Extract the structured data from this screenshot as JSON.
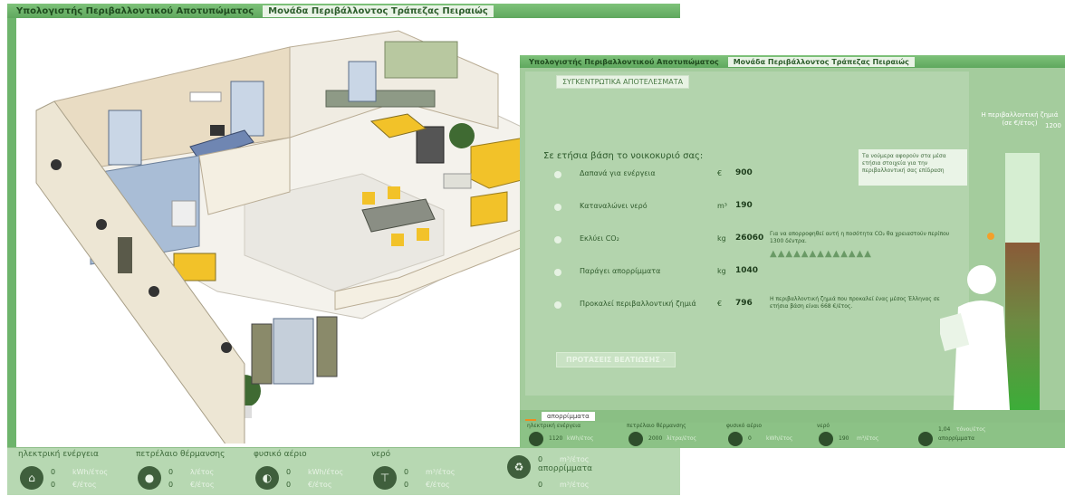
{
  "colors": {
    "title_bar": "#5fa85e",
    "panel_green": "#a4cc9d",
    "footer_green": "#b7d8b2",
    "accent_orange": "#f08a1e",
    "furniture_yellow": "#f2c229"
  },
  "window_main": {
    "tabs": [
      "Υπολογιστής Περιβαλλοντικού Αποτυπώματος",
      "Μονάδα Περιβάλλοντος Τράπεζας Πειραιώς"
    ],
    "footer": {
      "categories": [
        {
          "title": "ηλεκτρική ενέργεια",
          "icon": "house-icon",
          "v1": "0",
          "u1": "kWh/έτος",
          "v2": "0",
          "u2": "€/έτος"
        },
        {
          "title": "πετρέλαιο θέρμανσης",
          "icon": "oil-drop-icon",
          "v1": "0",
          "u1": "λ/έτος",
          "v2": "0",
          "u2": "€/έτος"
        },
        {
          "title": "φυσικό αέριο",
          "icon": "gas-icon",
          "v1": "0",
          "u1": "kWh/έτος",
          "v2": "0",
          "u2": "€/έτος"
        },
        {
          "title": "νερό",
          "icon": "tap-icon",
          "v1": "0",
          "u1": "m³/έτος",
          "v2": "0",
          "u2": "€/έτος"
        },
        {
          "title": "απορρίμματα",
          "icon": "recycle-bin-icon",
          "v1": "0",
          "u1": "m³/έτος",
          "v2": "0",
          "u2": "m³/έτος"
        }
      ]
    }
  },
  "window_results": {
    "tabs": [
      "Υπολογιστής Περιβαλλοντικού Αποτυπώματος",
      "Μονάδα Περιβάλλοντος Τράπεζας Πειραιώς"
    ],
    "summary_tab": "ΣΥΓΚΕΝΤΡΩΤΙΚΑ ΑΠΟΤΕΛΕΣΜΑΤΑ",
    "heading": "Σε ετήσια βάση το νοικοκυριό σας:",
    "rows": [
      {
        "label": "Δαπανά για ενέργεια",
        "unit": "€",
        "value": "900",
        "note": ""
      },
      {
        "label": "Καταναλώνει νερό",
        "unit": "m³",
        "value": "190",
        "note": ""
      },
      {
        "label": "Εκλύει CO₂",
        "unit": "kg",
        "value": "26060",
        "note": "Για να απορροφηθεί αυτή η ποσότητα CO₂ θα χρειαστούν περίπου 1300 δέντρα."
      },
      {
        "label": "Παράγει απορρίμματα",
        "unit": "kg",
        "value": "1040",
        "note": ""
      },
      {
        "label": "Προκαλεί περιβαλλοντική ζημιά",
        "unit": "€",
        "value": "796",
        "note": "Η περιβαλλοντική ζημιά που προκαλεί ένας μέσος Έλληνας σε ετήσια βάση είναι 668 €/έτος."
      }
    ],
    "trees_glyphs": "▲▲▲▲▲▲▲▲▲▲▲▲▲",
    "proposals_button": "ΠΡΟΤΑΣΕΙΣ ΒΕΛΤΙΩΣΗΣ",
    "tooltip": "Τα νούμερα αφορούν στα μέσα ετήσια στοιχεία για την περιβαλλοντική σας επίδραση",
    "gauge": {
      "title": "Η περιβαλλοντική ζημιά (σε €/έτος)",
      "max_label": "1200",
      "fill_fraction": 0.66
    },
    "bottom_tab_label": "απορρίμματα",
    "footer": [
      {
        "title": "ηλεκτρική ενέργεια",
        "v": "1120",
        "u": "kWh/έτος"
      },
      {
        "title": "πετρέλαιο θέρμανσης",
        "v": "2000",
        "u": "λίτρα/έτος"
      },
      {
        "title": "φυσικό αέριο",
        "v": "0",
        "u": "kWh/έτος"
      },
      {
        "title": "νερό",
        "v": "190",
        "u": "m³/έτος"
      },
      {
        "title": "",
        "v": "1,04",
        "u": "τόνοι/έτος",
        "extra": "απορρίμματα"
      }
    ]
  }
}
